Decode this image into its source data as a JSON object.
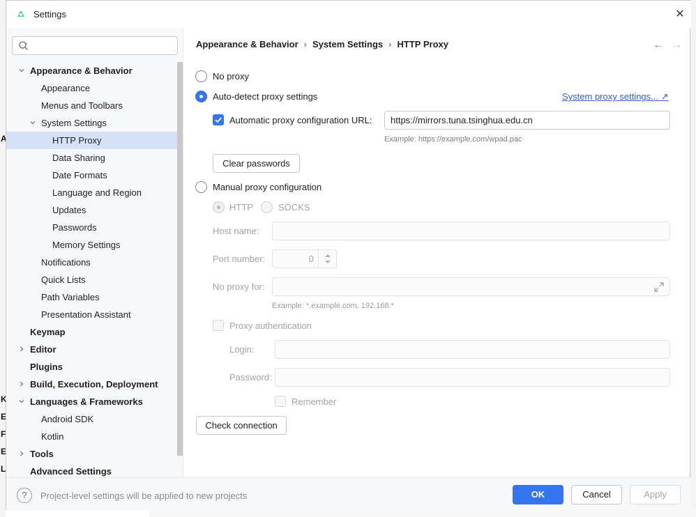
{
  "window": {
    "title": "Settings",
    "close_glyph": "✕"
  },
  "background": {
    "letters": [
      "A",
      "K",
      "E",
      "F",
      "E",
      "L"
    ]
  },
  "sidebar": {
    "search_placeholder": "",
    "items": [
      {
        "label": "Appearance & Behavior",
        "bold": true,
        "expanded": true
      },
      {
        "label": "Appearance"
      },
      {
        "label": "Menus and Toolbars"
      },
      {
        "label": "System Settings",
        "expanded": true
      },
      {
        "label": "HTTP Proxy",
        "selected": true
      },
      {
        "label": "Data Sharing"
      },
      {
        "label": "Date Formats"
      },
      {
        "label": "Language and Region"
      },
      {
        "label": "Updates"
      },
      {
        "label": "Passwords"
      },
      {
        "label": "Memory Settings"
      },
      {
        "label": "Notifications"
      },
      {
        "label": "Quick Lists"
      },
      {
        "label": "Path Variables"
      },
      {
        "label": "Presentation Assistant"
      },
      {
        "label": "Keymap",
        "bold": true
      },
      {
        "label": "Editor",
        "bold": true,
        "expanded": false
      },
      {
        "label": "Plugins",
        "bold": true
      },
      {
        "label": "Build, Execution, Deployment",
        "bold": true,
        "expanded": false
      },
      {
        "label": "Languages & Frameworks",
        "bold": true,
        "expanded": true
      },
      {
        "label": "Android SDK"
      },
      {
        "label": "Kotlin"
      },
      {
        "label": "Tools",
        "bold": true,
        "expanded": false
      },
      {
        "label": "Advanced Settings",
        "bold": true
      }
    ]
  },
  "breadcrumb": {
    "parts": [
      "Appearance & Behavior",
      "System Settings",
      "HTTP Proxy"
    ],
    "separator": "›"
  },
  "nav": {
    "back_glyph": "←",
    "forward_glyph": "→"
  },
  "proxy": {
    "no_proxy_label": "No proxy",
    "auto_detect_label": "Auto-detect proxy settings",
    "system_proxy_link": "System proxy settings... ↗",
    "auto_config_url_label": "Automatic proxy configuration URL:",
    "auto_config_url_value": "https://mirrors.tuna.tsinghua.edu.cn",
    "auto_config_example": "Example: https://example.com/wpad.pac",
    "clear_passwords_label": "Clear passwords",
    "manual_label": "Manual proxy configuration",
    "http_label": "HTTP",
    "socks_label": "SOCKS",
    "host_name_label": "Host name:",
    "host_name_value": "",
    "port_number_label": "Port number:",
    "port_number_value": "0",
    "no_proxy_for_label": "No proxy for:",
    "no_proxy_for_value": "",
    "no_proxy_example": "Example: *.example.com, 192.168.*",
    "proxy_auth_label": "Proxy authentication",
    "login_label": "Login:",
    "login_value": "",
    "password_label": "Password:",
    "password_value": "",
    "remember_label": "Remember",
    "check_connection_label": "Check connection",
    "selected_mode": "auto-detect"
  },
  "footer": {
    "help_glyph": "?",
    "text": "Project-level settings will be applied to new projects",
    "ok_label": "OK",
    "cancel_label": "Cancel",
    "apply_label": "Apply"
  },
  "colors": {
    "accent": "#3574f0",
    "selection": "#d5e1f6",
    "link": "#2f5fcf"
  }
}
